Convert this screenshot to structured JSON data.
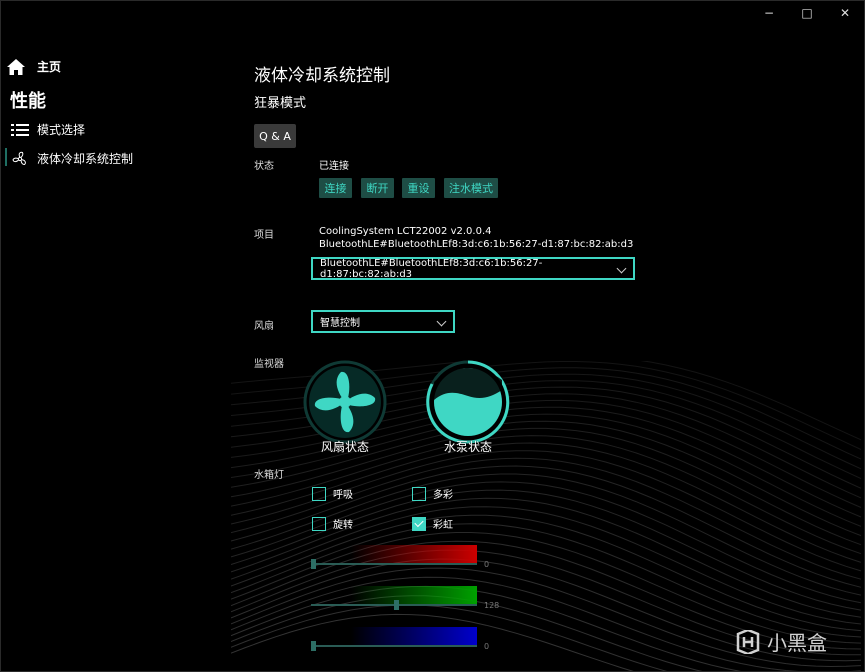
{
  "window_controls": {
    "minimize": "−",
    "maximize": "□",
    "close": "✕"
  },
  "nav": {
    "home_label": "主页",
    "header": "性能",
    "items": [
      {
        "label": "模式选择",
        "icon": "list-icon"
      },
      {
        "label": "液体冷却系统控制",
        "icon": "fan-icon"
      }
    ]
  },
  "page": {
    "title": "液体冷却系统控制",
    "subtitle": "狂暴模式",
    "qa_button": "Q & A"
  },
  "status": {
    "label": "状态",
    "value": "已连接",
    "buttons": [
      "连接",
      "断开",
      "重设",
      "注水模式"
    ]
  },
  "project": {
    "label": "项目",
    "line1": "CoolingSystem LCT22002 v2.0.0.4",
    "line2": "BluetoothLE#BluetoothLEf8:3d:c6:1b:56:27-d1:87:bc:82:ab:d3",
    "selected": "BluetoothLE#BluetoothLEf8:3d:c6:1b:56:27-d1:87:bc:82:ab:d3"
  },
  "fan": {
    "label": "风扇",
    "selected": "智慧控制"
  },
  "monitor": {
    "label": "监视器",
    "fan_status": "风扇状态",
    "pump_status": "水泵状态"
  },
  "lights": {
    "label": "水箱灯",
    "options": [
      {
        "label": "呼吸",
        "checked": false
      },
      {
        "label": "多彩",
        "checked": false
      },
      {
        "label": "旋转",
        "checked": false
      },
      {
        "label": "彩虹",
        "checked": true
      }
    ]
  },
  "rgb": {
    "red": {
      "value": "0",
      "level": 0,
      "color": "#cc0000"
    },
    "green": {
      "value": "128",
      "level": 0.5,
      "color": "#00a000"
    },
    "blue": {
      "value": "0",
      "level": 0,
      "color": "#0000cc"
    }
  },
  "watermark": {
    "text": "小黑盒"
  },
  "colors": {
    "accent": "#3fd7c4",
    "button_bg": "#1e4d45"
  }
}
